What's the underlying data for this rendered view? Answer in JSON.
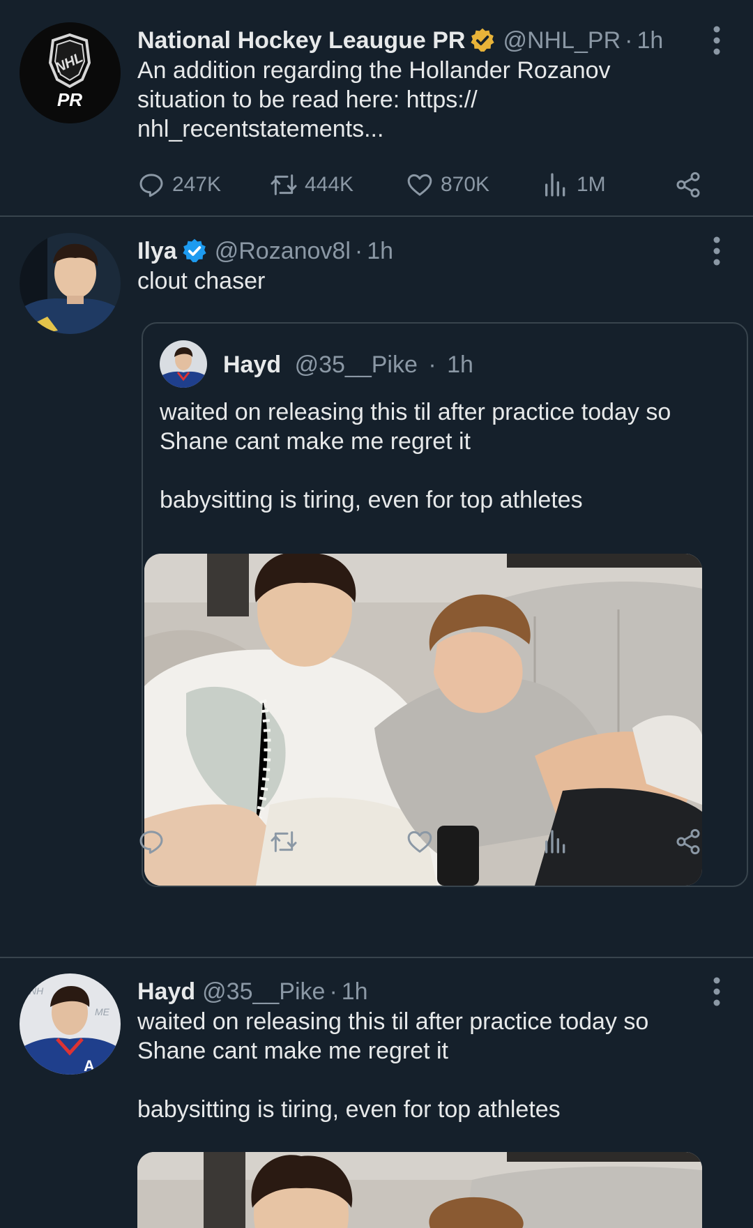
{
  "tweets": [
    {
      "name": "National Hockey Leaugue PR",
      "handle": "@NHL_PR",
      "sep": "·",
      "time": "1h",
      "avatar_label": "PR",
      "text": "An addition regarding the Hollander Rozanov\nsituation to be read here: https://\nnhl_recentstatements...",
      "badge": "gold-verified",
      "stats": {
        "replies": "247K",
        "retweets": "444K",
        "likes": "870K",
        "views": "1M"
      }
    },
    {
      "name": "Ilya",
      "handle": "@Rozanov8l",
      "sep": "·",
      "time": "1h",
      "text": "clout chaser",
      "badge": "blue-verified",
      "quote": {
        "name": "Hayd",
        "handle": "@35__Pike",
        "sep": "·",
        "time": "1h",
        "text": "waited on releasing this til after practice today so\nShane cant make me regret it\n\nbabysitting is tiring, even for top athletes"
      }
    },
    {
      "name": "Hayd",
      "handle": "@35__Pike",
      "sep": "·",
      "time": "1h",
      "text": "waited on releasing this til after practice today so\nShane cant make me regret it\n\nbabysitting is tiring, even for top athletes"
    }
  ],
  "colors": {
    "background": "#15202b",
    "divider": "#38444d",
    "muted": "#8b98a5",
    "gold": "#e8b339",
    "blue": "#1d9bf0"
  }
}
